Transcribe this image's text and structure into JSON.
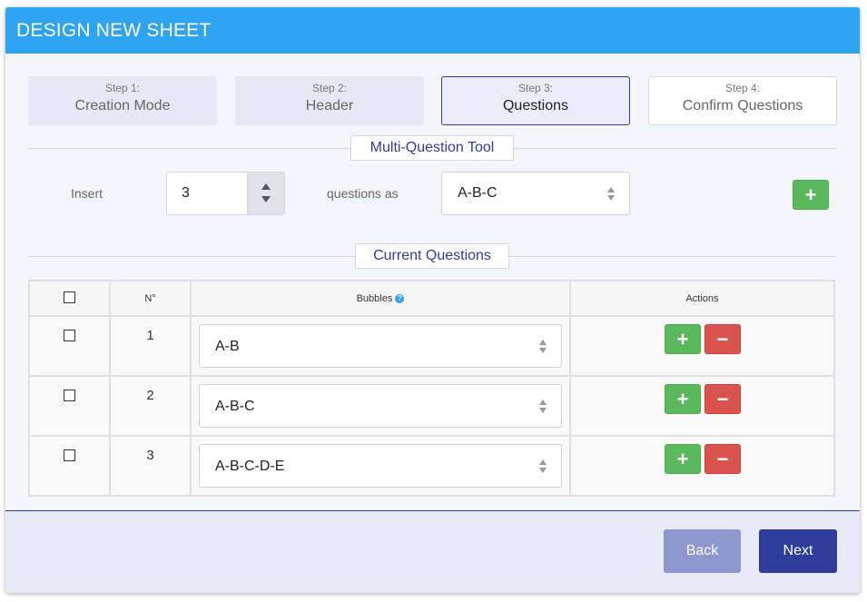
{
  "header": {
    "title": "DESIGN NEW SHEET"
  },
  "steps": [
    {
      "num": "Step 1:",
      "label": "Creation Mode"
    },
    {
      "num": "Step 2:",
      "label": "Header"
    },
    {
      "num": "Step 3:",
      "label": "Questions"
    },
    {
      "num": "Step 4:",
      "label": "Confirm Questions"
    }
  ],
  "multi_tool": {
    "title": "Multi-Question Tool",
    "insert_label": "Insert",
    "quantity": "3",
    "questions_as_label": "questions as",
    "bubble_type": "A-B-C",
    "add_symbol": "+"
  },
  "current": {
    "title": "Current Questions",
    "headers": {
      "number": "N°",
      "bubbles": "Bubbles",
      "actions": "Actions"
    },
    "help_symbol": "?",
    "rows": [
      {
        "number": "1",
        "bubbles": "A-B"
      },
      {
        "number": "2",
        "bubbles": "A-B-C"
      },
      {
        "number": "3",
        "bubbles": "A-B-C-D-E"
      }
    ],
    "add_symbol": "+",
    "remove_symbol": "−"
  },
  "footer": {
    "back_label": "Back",
    "next_label": "Next"
  },
  "colors": {
    "header": "#2ea3f2",
    "primary": "#2e3d99",
    "success": "#5cb85c",
    "danger": "#d9534f"
  }
}
